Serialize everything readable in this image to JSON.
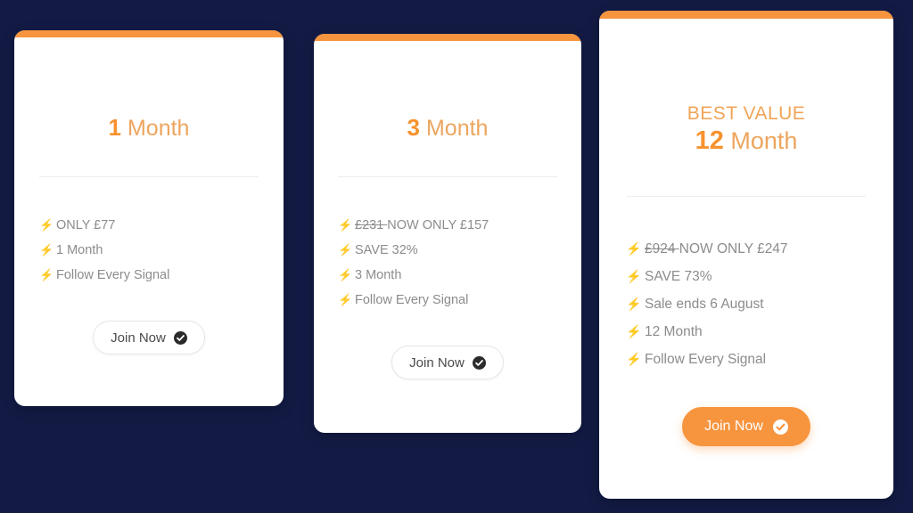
{
  "theme": {
    "background": "#131b45",
    "card_background": "#ffffff",
    "accent_orange": "#f7943e",
    "accent_orange_light": "#eda55e",
    "bolt_color": "#f5a85c",
    "feature_text": "#8c8c8c",
    "divider": "#ececec"
  },
  "icons": {
    "bolt": "bolt-icon",
    "check_circle": "check-circle-icon"
  },
  "cards": [
    {
      "id": "plan-1-month",
      "badge": "",
      "number": "1",
      "period": "Month",
      "features": [
        {
          "prefix_struck": "",
          "text": "ONLY £77"
        },
        {
          "prefix_struck": "",
          "text": "1 Month"
        },
        {
          "prefix_struck": "",
          "text": "Follow Every Signal"
        }
      ],
      "cta": {
        "label": "Join Now",
        "style": "ghost"
      }
    },
    {
      "id": "plan-3-month",
      "badge": "",
      "number": "3",
      "period": "Month",
      "features": [
        {
          "prefix_struck": "£231",
          "text": "NOW ONLY £157"
        },
        {
          "prefix_struck": "",
          "text": "SAVE 32%"
        },
        {
          "prefix_struck": "",
          "text": "3 Month"
        },
        {
          "prefix_struck": "",
          "text": "Follow Every Signal"
        }
      ],
      "cta": {
        "label": "Join Now",
        "style": "ghost"
      }
    },
    {
      "id": "plan-12-month",
      "badge": "BEST VALUE",
      "number": "12",
      "period": "Month",
      "features": [
        {
          "prefix_struck": "£924",
          "text": "NOW ONLY £247"
        },
        {
          "prefix_struck": "",
          "text": "SAVE 73%"
        },
        {
          "prefix_struck": "",
          "text": "Sale ends 6 August"
        },
        {
          "prefix_struck": "",
          "text": "12 Month"
        },
        {
          "prefix_struck": "",
          "text": "Follow Every Signal"
        }
      ],
      "cta": {
        "label": "Join Now",
        "style": "solid"
      }
    }
  ]
}
